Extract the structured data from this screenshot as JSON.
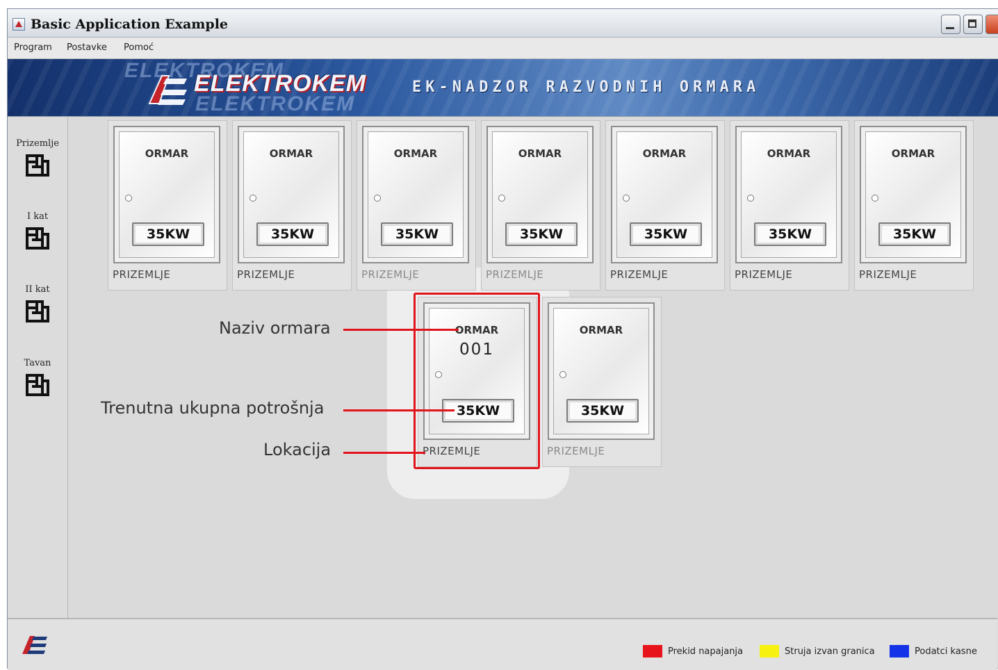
{
  "window": {
    "title": "Basic Application Example"
  },
  "menu": [
    "Program",
    "Postavke",
    "Pomoć"
  ],
  "banner": {
    "logo_text": "ELEKTROKEM",
    "title": "EK-NADZOR RAZVODNIH ORMARA"
  },
  "sidebar": {
    "floors": [
      {
        "label": "Prizemlje",
        "icon": "floor-plan-icon"
      },
      {
        "label": "I kat",
        "icon": "floor-plan-icon"
      },
      {
        "label": "II kat",
        "icon": "floor-plan-icon"
      },
      {
        "label": "Tavan",
        "icon": "floor-plan-icon"
      }
    ]
  },
  "cabinets_top": [
    {
      "title": "ORMAR",
      "power": "35KW",
      "location": "PRIZEMLJE"
    },
    {
      "title": "ORMAR",
      "power": "35KW",
      "location": "PRIZEMLJE"
    },
    {
      "title": "ORMAR",
      "power": "35KW",
      "location": "PRIZEMLJE"
    },
    {
      "title": "ORMAR",
      "power": "35KW",
      "location": "PRIZEMLJE"
    },
    {
      "title": "ORMAR",
      "power": "35KW",
      "location": "PRIZEMLJE"
    },
    {
      "title": "ORMAR",
      "power": "35KW",
      "location": "PRIZEMLJE"
    },
    {
      "title": "ORMAR",
      "power": "35KW",
      "location": "PRIZEMLJE"
    }
  ],
  "cabinets_bottom": [
    {
      "title": "ORMAR",
      "id": "001",
      "power": "35KW",
      "location": "PRIZEMLJE"
    },
    {
      "title": "ORMAR",
      "power": "35KW",
      "location": "PRIZEMLJE"
    }
  ],
  "annotations": {
    "name": "Naziv ormara",
    "consumption": "Trenutna ukupna potrošnja",
    "location": "Lokacija"
  },
  "legend": [
    {
      "label": "Prekid napajanja",
      "color": "#e8141b"
    },
    {
      "label": "Struja izvan granica",
      "color": "#f7f10f"
    },
    {
      "label": "Podatci kasne",
      "color": "#1432e8"
    }
  ]
}
